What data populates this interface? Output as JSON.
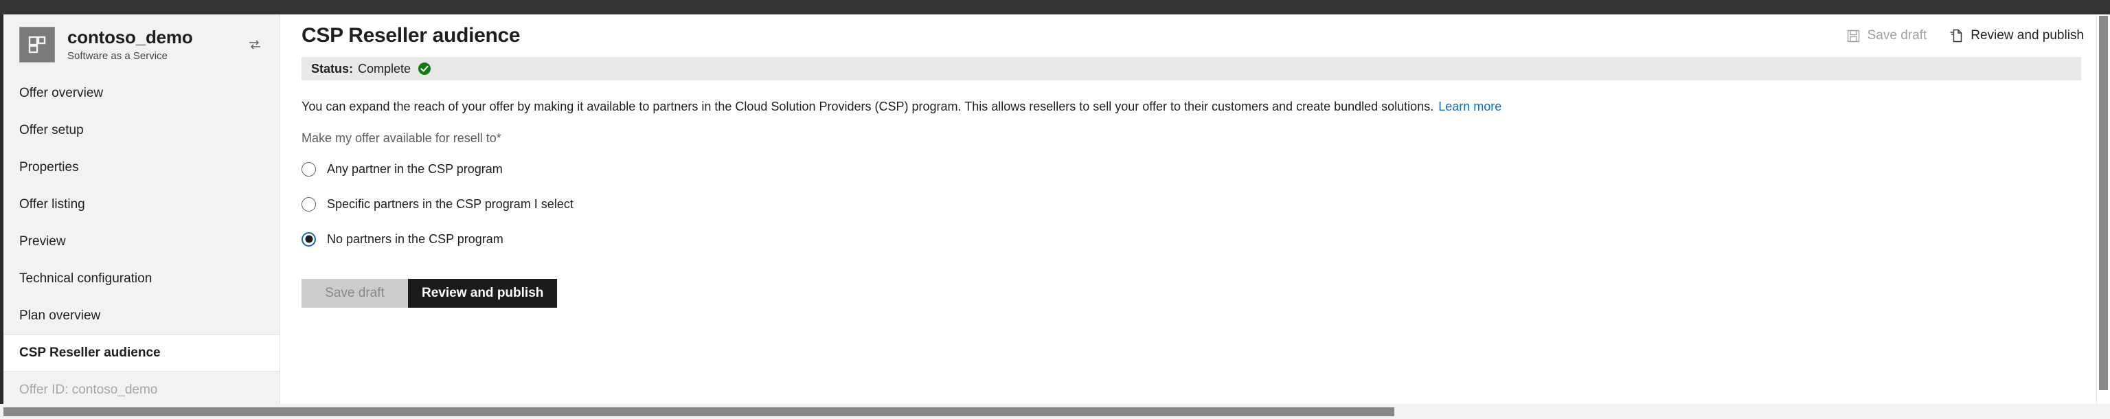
{
  "sidebar": {
    "offer": {
      "name": "contoso_demo",
      "subtitle": "Software as a Service",
      "icon": "app-tile-icon",
      "swap_icon": "swap-offer-icon"
    },
    "items": [
      {
        "label": "Offer overview",
        "selected": false
      },
      {
        "label": "Offer setup",
        "selected": false
      },
      {
        "label": "Properties",
        "selected": false
      },
      {
        "label": "Offer listing",
        "selected": false
      },
      {
        "label": "Preview",
        "selected": false
      },
      {
        "label": "Technical configuration",
        "selected": false
      },
      {
        "label": "Plan overview",
        "selected": false
      },
      {
        "label": "CSP Reseller audience",
        "selected": true
      }
    ],
    "footer_label": "Offer ID: contoso_demo"
  },
  "header": {
    "title": "CSP Reseller audience",
    "commands": [
      {
        "label": "Save draft",
        "icon": "save-floppy-icon",
        "disabled": true
      },
      {
        "label": "Review and publish",
        "icon": "publish-document-icon",
        "disabled": false
      }
    ]
  },
  "status": {
    "label": "Status:",
    "value": "Complete",
    "icon": "green-check-circle-icon",
    "color": "#107c10"
  },
  "main": {
    "description": "You can expand the reach of your offer by making it available to partners in the Cloud Solution Providers (CSP) program. This allows resellers to sell your offer to their customers and create bundled solutions.",
    "learn_more": "Learn more",
    "field_label": "Make my offer available for resell to",
    "required_marker": "*",
    "options": [
      {
        "label": "Any partner in the CSP program",
        "selected": false
      },
      {
        "label": "Specific partners in the CSP program I select",
        "selected": false
      },
      {
        "label": "No partners in the CSP program",
        "selected": true
      }
    ],
    "buttons": {
      "save_draft": "Save draft",
      "review_publish": "Review and publish"
    }
  },
  "colors": {
    "accent_link": "#0f6cbd",
    "radio_selected": "#0f6cbd",
    "status_green": "#107c10",
    "chrome_dark": "#333333",
    "sidebar_bg": "#f3f2f1"
  }
}
